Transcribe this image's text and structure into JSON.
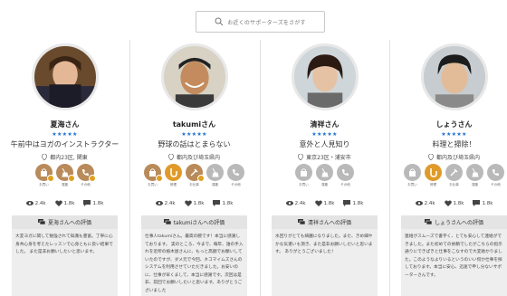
{
  "search": {
    "placeholder": "お近くのサポーターズをさがす"
  },
  "cards": [
    {
      "name": "夏海さん",
      "stars": "★★★★★",
      "tagline": "午前中はヨガのインストラクター",
      "area": "都内23区, 関東",
      "skills": [
        {
          "label": "お買い",
          "checked": true
        },
        {
          "label": "運搬",
          "checked": true
        },
        {
          "label": "その他",
          "checked": true
        }
      ],
      "stats": {
        "views": "2.4k",
        "likes": "1.8k",
        "comments": "1.8k"
      },
      "review_title": "夏海さんへの評価",
      "review_text": "大変ヨガに関して勉強されて知識も豊富。丁寧に心身共心身を考えたレッスンで心身ともに良い結果でした。 また是非お願いしたいと思います。"
    },
    {
      "name": "takumiさん",
      "stars": "★★★★★",
      "tagline": "野球の話はとまらない",
      "area": "都内及び埼玉県内",
      "skills": [
        {
          "label": "お買い",
          "checked": true
        },
        {
          "label": "修理",
          "checked": true
        },
        {
          "label": "お仕事",
          "checked": true
        },
        {
          "label": "運搬",
          "checked": false
        },
        {
          "label": "その他",
          "checked": false
        }
      ],
      "stats": {
        "views": "2.4k",
        "likes": "1.8k",
        "comments": "1.8k"
      },
      "review_title": "takumiさんへの評価",
      "review_text": "仕事人takumiさん。最高の腕です！本当に感謝しております。 実のところ、今まで、毎年、誰の手入れを近所の植木屋さんに、もっと高額でお願いしていたのですが、ダメ元で今回、ネコマイムズさんのシステムを利用させていただきました。お安いのに、仕事が早くまして、本当に感謝です。次回は是非、前回でお願いしたいと思います。ありがとうございました"
    },
    {
      "name": "清祥さん",
      "stars": "★★★★★",
      "tagline": "意外と人見知り",
      "area": "東京23区・浦安市",
      "skills": [
        {
          "label": "お買い",
          "checked": false
        },
        {
          "label": "運搬",
          "checked": false
        },
        {
          "label": "その他",
          "checked": false
        }
      ],
      "stats": {
        "views": "2.4k",
        "likes": "1.8k",
        "comments": "1.8k"
      },
      "review_title": "清祥さんへの評価",
      "review_text": "水回りがとても綺麗になりました。また、きめ細やかな気遣いも頂き、また是非お願いしたいと思います。 ありがとうございました！"
    },
    {
      "name": "しょうさん",
      "stars": "★★★★★",
      "tagline": "料理と掃除！",
      "area": "都内及び埼玉県内",
      "skills": [
        {
          "label": "お買い",
          "checked": false
        },
        {
          "label": "修理",
          "checked": true
        },
        {
          "label": "お仕事",
          "checked": false
        },
        {
          "label": "運搬",
          "checked": false
        },
        {
          "label": "その他",
          "checked": false
        }
      ],
      "stats": {
        "views": "2.4k",
        "likes": "1.8k",
        "comments": "1.8k"
      },
      "review_title": "しょうさんへの評価",
      "review_text": "連絡がスムーズで書字く、とても安心して連絡ができました。また初めての依頼でしたがこちらの指示通りにできぱきと仕事をこなすので大変助かりました。このようなよりいるというのいい何か仕事を探しております。本当に安心、迅速で申し分ないサポーターさんです。"
    }
  ],
  "colors": {
    "star": "#1a6fd0",
    "badge": "#e0a020",
    "skill_active": "#e09a2a",
    "skill_inactive": "#b9b9b9"
  }
}
